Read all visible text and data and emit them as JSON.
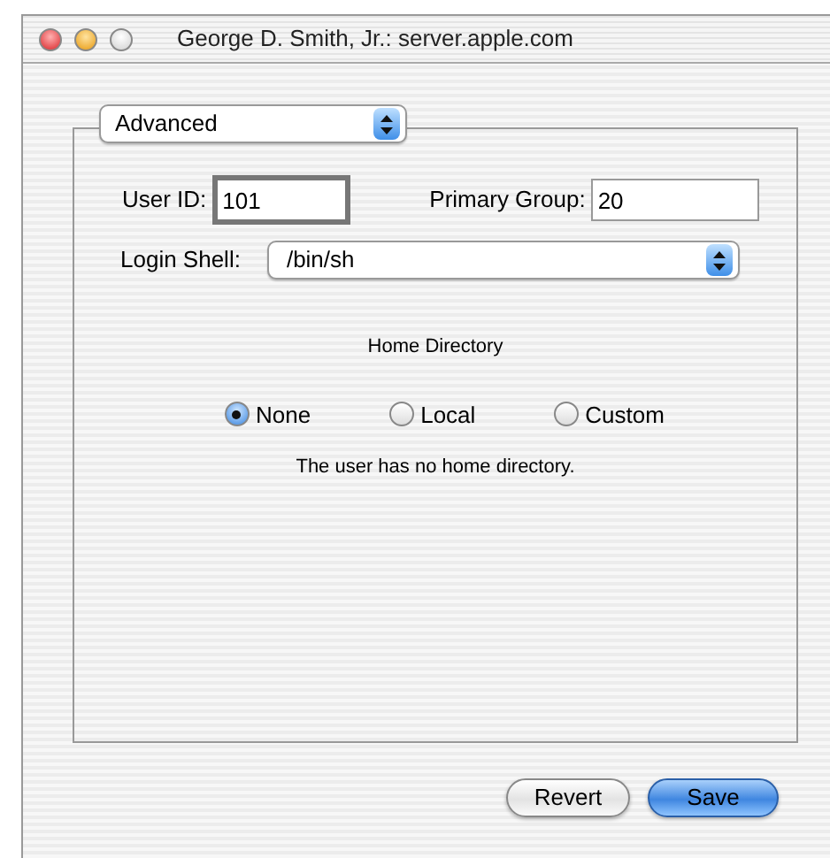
{
  "window": {
    "title": "George D. Smith, Jr.: server.apple.com"
  },
  "view_popup": {
    "value": "Advanced"
  },
  "fields": [
    {
      "label": "User ID:",
      "value": "101",
      "focused": true
    },
    {
      "label": "Primary Group:",
      "value": "20",
      "focused": false
    }
  ],
  "login_shell": {
    "label": "Login Shell:",
    "value": "/bin/sh"
  },
  "home_directory": {
    "heading": "Home Directory",
    "options": [
      {
        "label": "None",
        "selected": true
      },
      {
        "label": "Local",
        "selected": false
      },
      {
        "label": "Custom",
        "selected": false
      }
    ],
    "message": "The user has no home directory."
  },
  "buttons": [
    {
      "label": "Revert",
      "default": false
    },
    {
      "label": "Save",
      "default": true
    }
  ]
}
